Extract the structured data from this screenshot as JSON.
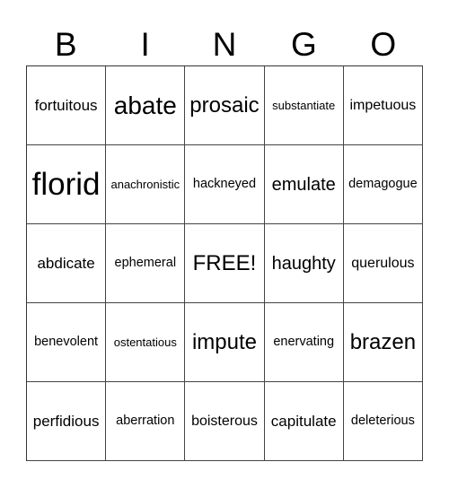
{
  "header": {
    "letters": [
      "B",
      "I",
      "N",
      "G",
      "O"
    ]
  },
  "board": {
    "rows": [
      [
        "fortuitous",
        "abate",
        "prosaic",
        "substantiate",
        "impetuous"
      ],
      [
        "florid",
        "anachronistic",
        "hackneyed",
        "emulate",
        "demagogue"
      ],
      [
        "abdicate",
        "ephemeral",
        "FREE!",
        "haughty",
        "querulous"
      ],
      [
        "benevolent",
        "ostentatious",
        "impute",
        "enervating",
        "brazen"
      ],
      [
        "perfidious",
        "aberration",
        "boisterous",
        "capitulate",
        "deleterious"
      ]
    ]
  }
}
